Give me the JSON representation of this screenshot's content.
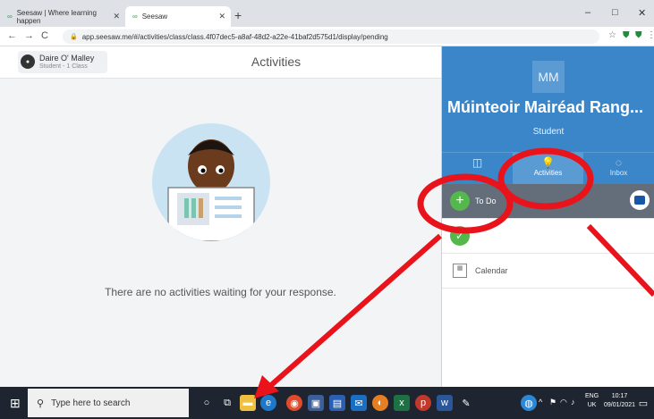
{
  "browser": {
    "tabs": [
      {
        "label": "Seesaw | Where learning happen",
        "active": false
      },
      {
        "label": "Seesaw",
        "active": true
      }
    ],
    "url": "app.seesaw.me/#/activities/class/class.4f07dec5-a8af-48d2-a22e-41baf2d575d1/display/pending",
    "window_controls": [
      "–",
      "□",
      "✕"
    ]
  },
  "header": {
    "user_name": "Daire O' Malley",
    "user_sub": "Student - 1 Class",
    "title": "Activities"
  },
  "main": {
    "empty_message": "There are no activities waiting for your response."
  },
  "panel": {
    "initials": "MM",
    "teacher_name": "Múinteoir Mairéad Rang...",
    "role": "Student",
    "tabs": [
      {
        "label": "",
        "icon": "book-icon"
      },
      {
        "label": "Activities",
        "icon": "bulb-icon"
      },
      {
        "label": "Inbox",
        "icon": "chat-icon"
      }
    ],
    "list": [
      {
        "label": "To Do",
        "icon": "plus-icon"
      },
      {
        "label": "",
        "icon": "check-icon"
      },
      {
        "label": "Calendar",
        "icon": "calendar-icon"
      }
    ]
  },
  "taskbar": {
    "search_placeholder": "Type here to search",
    "lang_top": "ENG",
    "lang_bottom": "UK",
    "time": "10:17",
    "date": "09/01/2021"
  },
  "colors": {
    "accent": "#3a86c8",
    "annotation": "#e8131b",
    "todo_green": "#55b84c"
  }
}
